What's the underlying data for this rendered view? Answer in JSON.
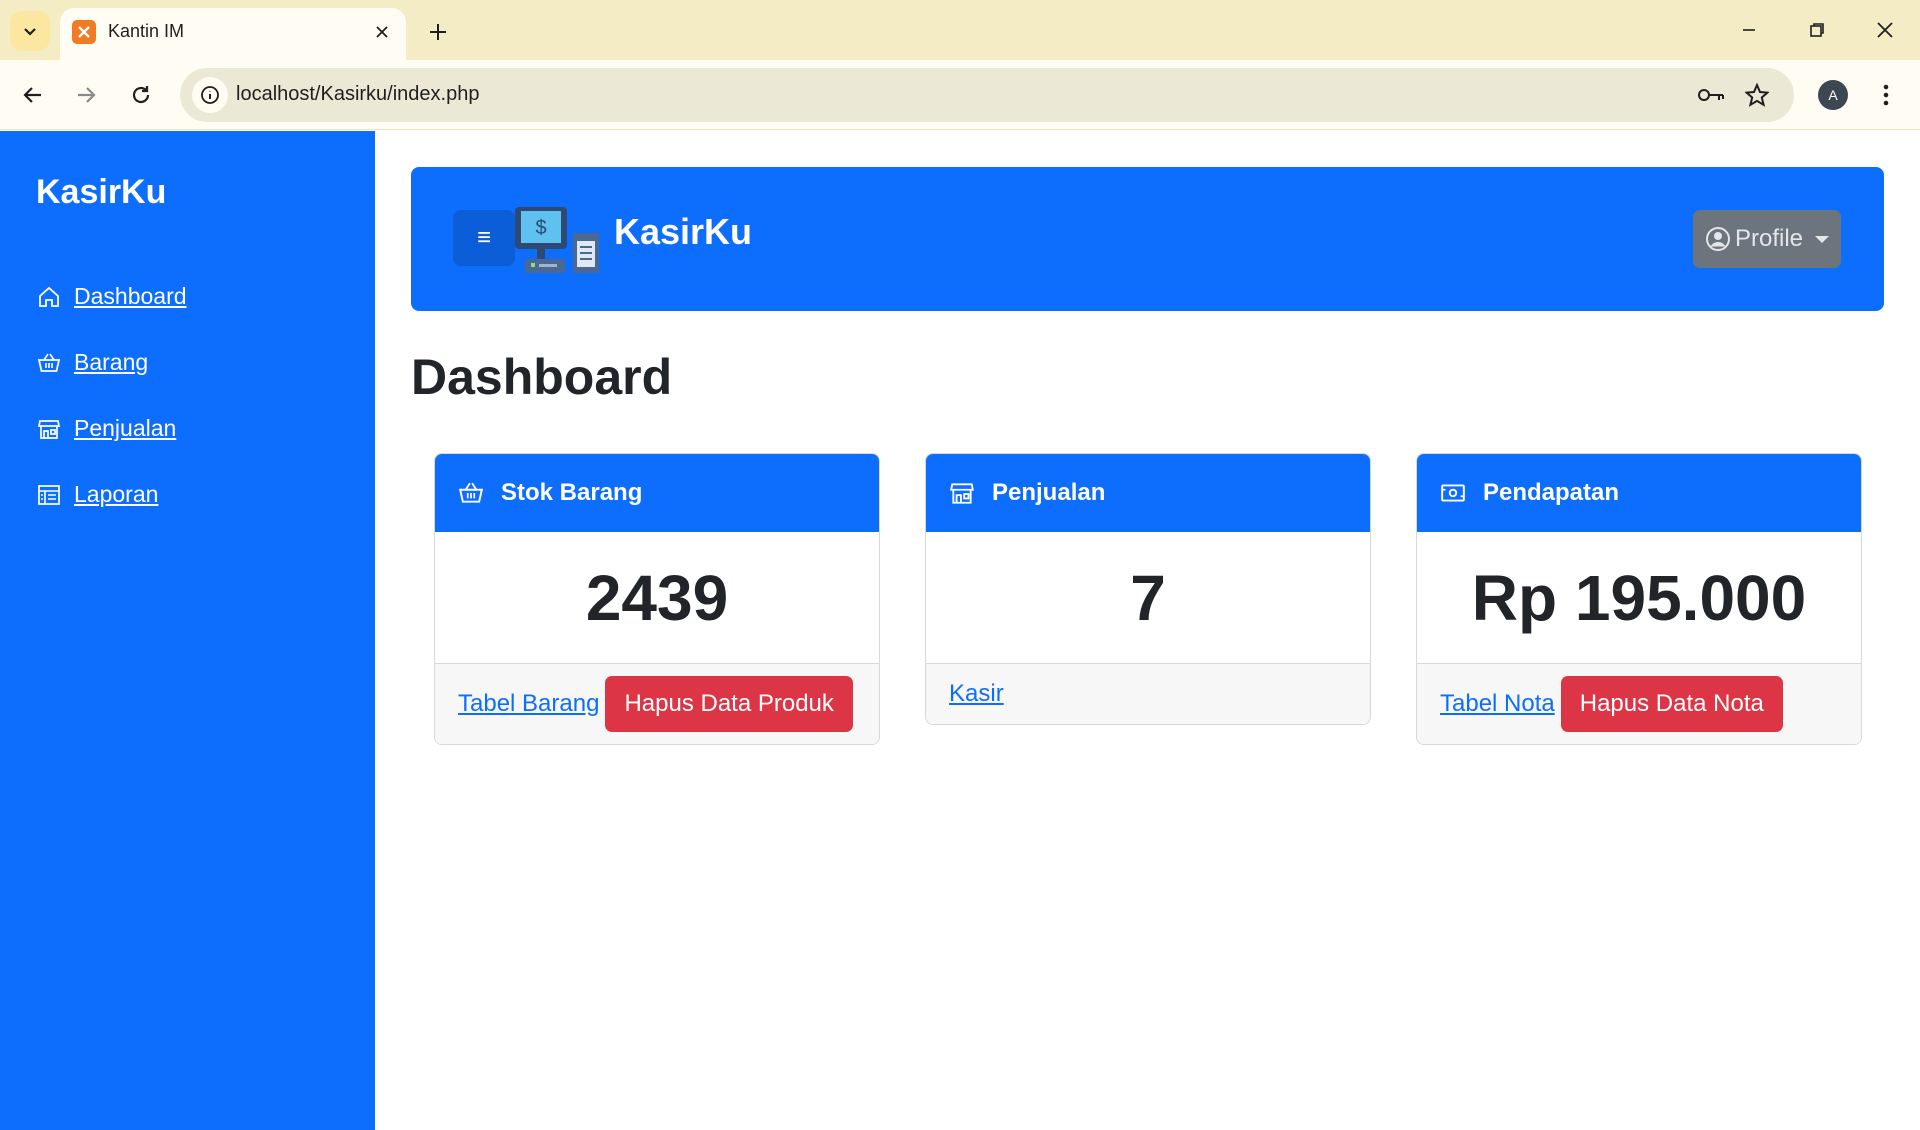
{
  "browser": {
    "tab_title": "Kantin IM",
    "url": "localhost/Kasirku/index.php",
    "profile_initial": "A"
  },
  "sidebar": {
    "brand": "KasirKu",
    "items": [
      {
        "label": "Dashboard",
        "icon": "home-icon"
      },
      {
        "label": "Barang",
        "icon": "basket-icon"
      },
      {
        "label": "Penjualan",
        "icon": "store-icon"
      },
      {
        "label": "Laporan",
        "icon": "report-icon"
      }
    ]
  },
  "header": {
    "title": "KasirKu",
    "toggle_label": "≡",
    "profile_label": "Profile"
  },
  "page_title": "Dashboard",
  "cards": [
    {
      "title": "Stok Barang",
      "icon": "basket-icon",
      "value": "2439",
      "link": "Tabel Barang",
      "button": "Hapus Data Produk"
    },
    {
      "title": "Penjualan",
      "icon": "store-icon",
      "value": "7",
      "link": "Kasir"
    },
    {
      "title": "Pendapatan",
      "icon": "cash-icon",
      "value": "Rp 195.000",
      "link": "Tabel Nota",
      "button": "Hapus Data Nota"
    }
  ],
  "colors": {
    "primary": "#0d6efd",
    "danger": "#dc3545",
    "secondary": "#6c757d",
    "chrome": "#f4ecc4"
  }
}
